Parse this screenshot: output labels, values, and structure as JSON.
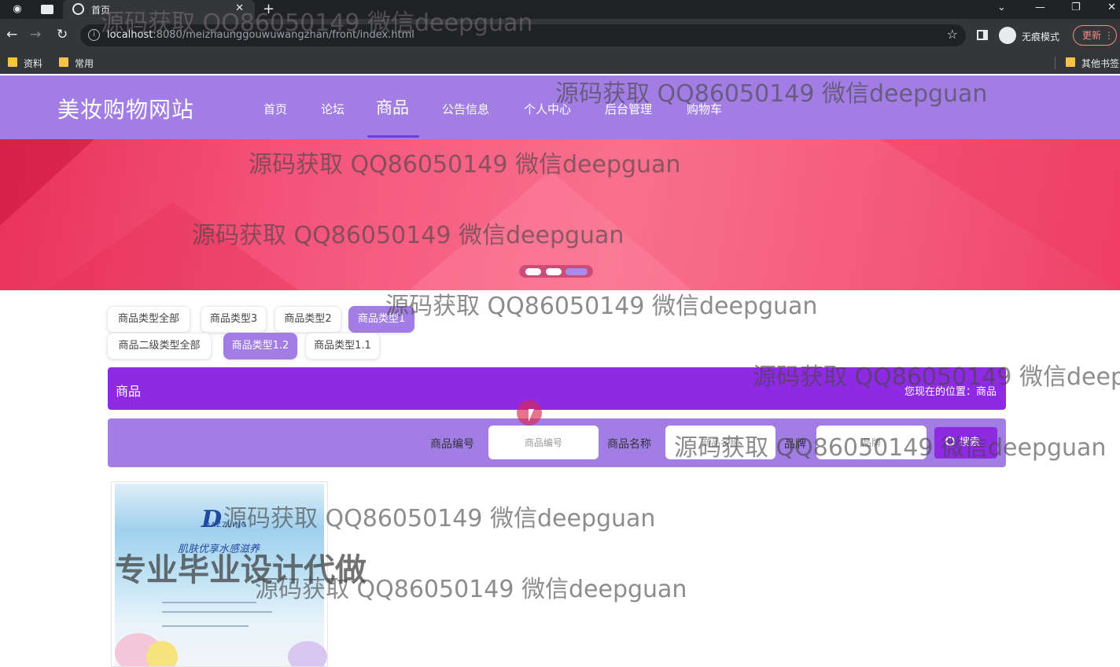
{
  "browser": {
    "tab_title": "首页",
    "url_host": "localhost",
    "url_rest": ":8080/meizhaunggouwuwangzhan/front/index.html",
    "incognito_label": "无痕模式",
    "update_label": "更新",
    "bookmarks": [
      "资料",
      "常用"
    ],
    "other_bookmarks": "其他书签"
  },
  "site": {
    "logo": "美妆购物网站",
    "nav": [
      "首页",
      "论坛",
      "商品",
      "公告信息",
      "个人中心",
      "后台管理",
      "购物车"
    ],
    "active_nav": "商品"
  },
  "banner": {
    "slides": 3,
    "active_slide": 3
  },
  "categories": {
    "level1": [
      "商品类型全部",
      "商品类型3",
      "商品类型2",
      "商品类型1"
    ],
    "level1_active": "商品类型1",
    "level2": [
      "商品二级类型全部",
      "商品类型1.2",
      "商品类型1.1"
    ],
    "level2_active": "商品类型1.2"
  },
  "section": {
    "title": "商品",
    "breadcrumb": "您现在的位置：商品"
  },
  "search": {
    "fields": [
      {
        "label": "商品编号",
        "placeholder": "商品编号"
      },
      {
        "label": "商品名称",
        "placeholder": "商品名称"
      },
      {
        "label": "品牌",
        "placeholder": "品牌"
      }
    ],
    "button": "搜索"
  },
  "product": {
    "logo": "D",
    "brand": "DAZZLING",
    "slogan": "肌肤优享水感滋养"
  },
  "watermarks": {
    "text": "源码获取 QQ86050149 微信deepguan",
    "big": "专业毕业设计代做"
  },
  "colors": {
    "header": "#a27ee4",
    "accent": "#8e2be2",
    "banner": "#f4527a"
  }
}
